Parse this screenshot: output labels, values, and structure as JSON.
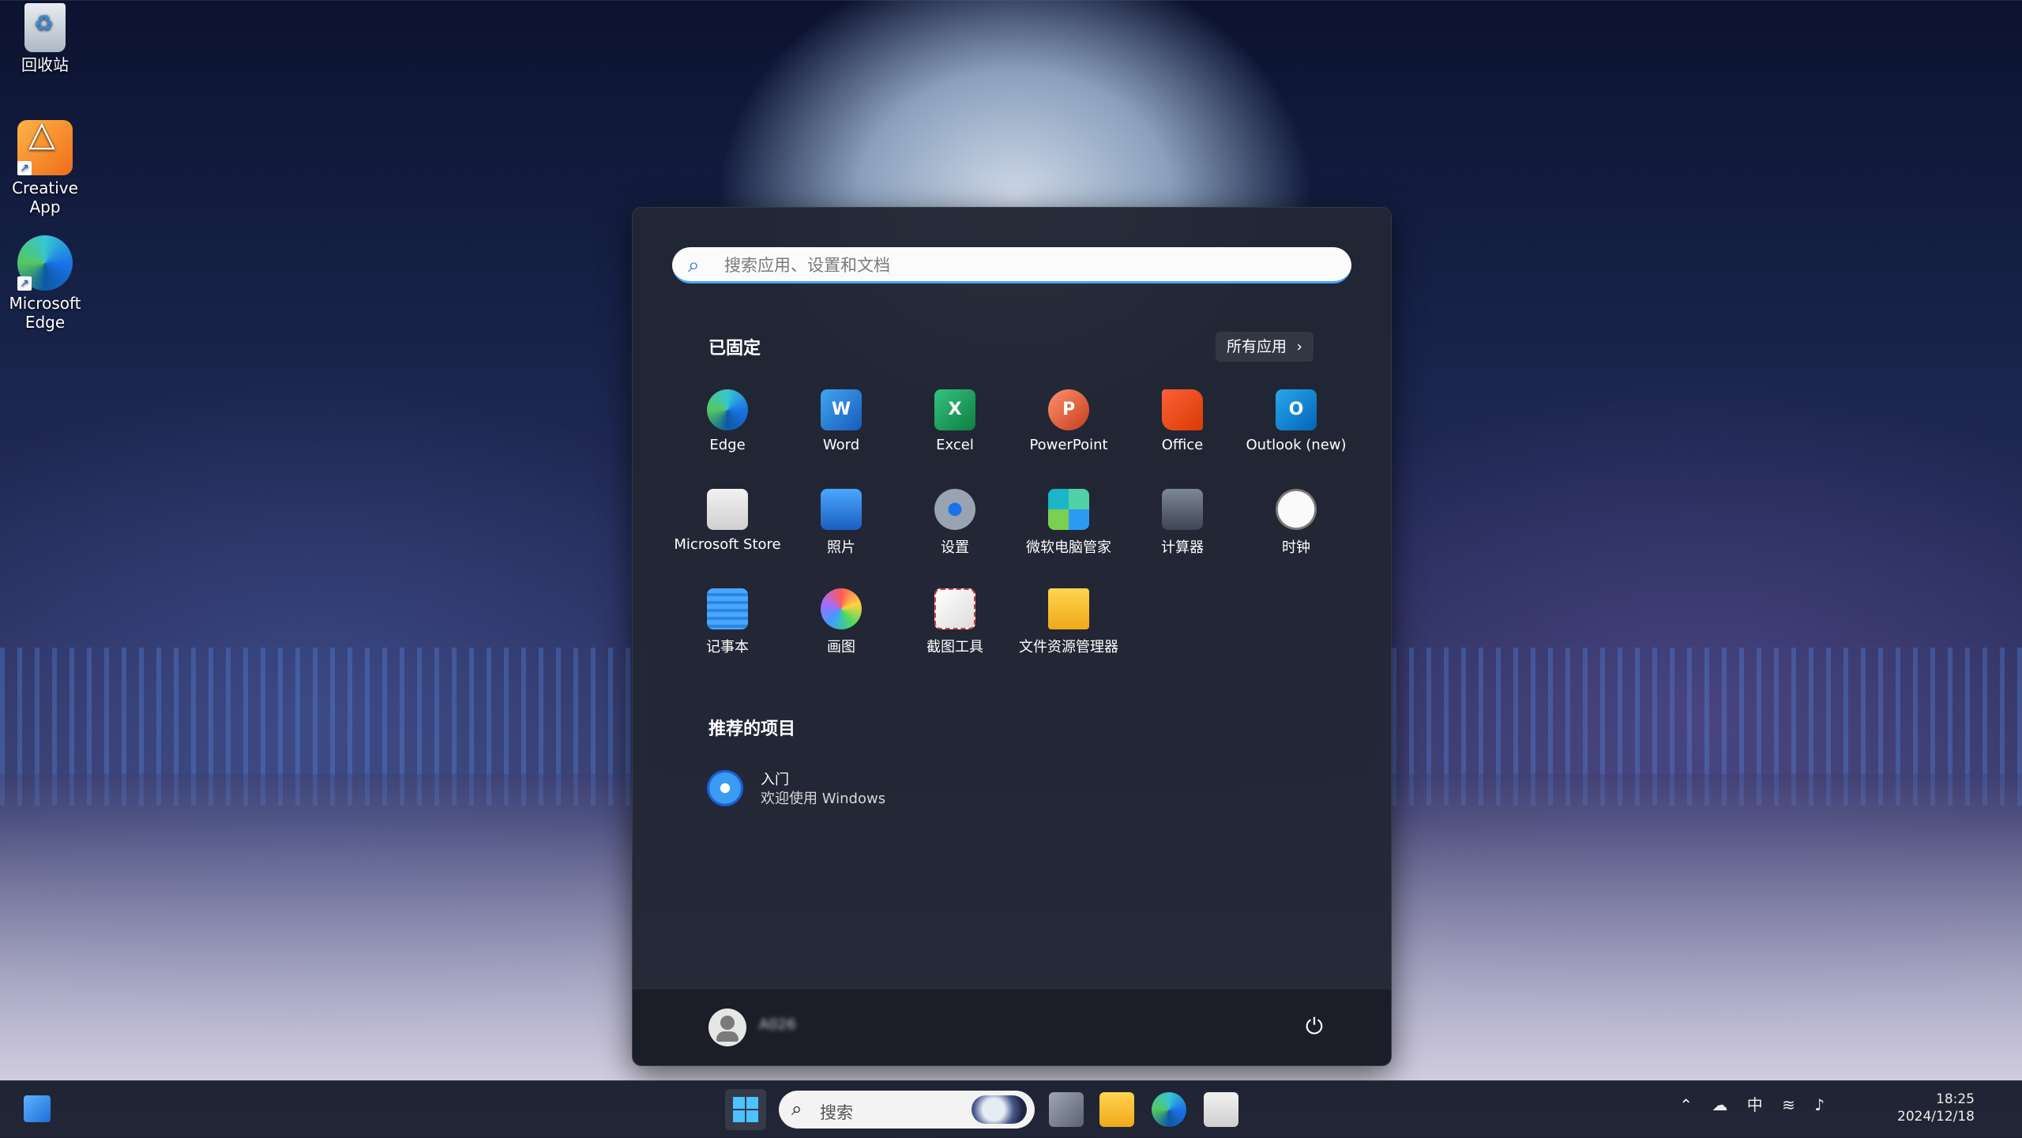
{
  "desktop": {
    "icons": [
      {
        "label": "回收站"
      },
      {
        "label": "Creative App"
      },
      {
        "label": "Microsoft Edge"
      }
    ]
  },
  "start_menu": {
    "search": {
      "placeholder": "搜索应用、设置和文档"
    },
    "pinned_title": "已固定",
    "all_apps_label": "所有应用",
    "pinned": [
      {
        "label": "Edge",
        "icon": "edge-icon"
      },
      {
        "label": "Word",
        "icon": "word-icon"
      },
      {
        "label": "Excel",
        "icon": "excel-icon"
      },
      {
        "label": "PowerPoint",
        "icon": "powerpoint-icon"
      },
      {
        "label": "Office",
        "icon": "office-icon"
      },
      {
        "label": "Outlook (new)",
        "icon": "outlook-icon"
      },
      {
        "label": "Microsoft Store",
        "icon": "store-icon"
      },
      {
        "label": "照片",
        "icon": "photos-icon"
      },
      {
        "label": "设置",
        "icon": "settings-icon"
      },
      {
        "label": "微软电脑管家",
        "icon": "pc-manager-icon"
      },
      {
        "label": "计算器",
        "icon": "calculator-icon"
      },
      {
        "label": "时钟",
        "icon": "clock-icon"
      },
      {
        "label": "记事本",
        "icon": "notepad-icon"
      },
      {
        "label": "画图",
        "icon": "paint-icon"
      },
      {
        "label": "截图工具",
        "icon": "snipping-tool-icon"
      },
      {
        "label": "文件资源管理器",
        "icon": "file-explorer-icon"
      }
    ],
    "recommended_title": "推荐的项目",
    "recommended": [
      {
        "title": "入门",
        "subtitle": "欢迎使用 Windows"
      }
    ],
    "user": {
      "name": "A026"
    }
  },
  "taskbar": {
    "search_label": "搜索",
    "tray": {
      "ime": "中"
    },
    "clock": {
      "time": "18:25",
      "date": "2024/12/18"
    }
  },
  "colors": {
    "accent": "#4cc2ff",
    "start_bg": "#222634",
    "taskbar_bg": "#1a1e2e"
  }
}
